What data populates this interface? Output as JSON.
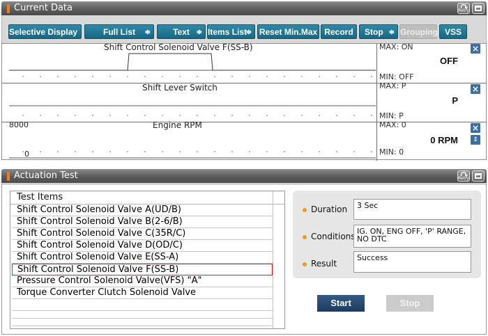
{
  "current_data": {
    "title": "Current Data",
    "retry_label": "Retry",
    "toolbar": [
      {
        "label": "Selective Display",
        "dropdown": true,
        "enabled": true
      },
      {
        "label": "Full List",
        "dropdown": true,
        "enabled": true
      },
      {
        "label": "Text",
        "dropdown": true,
        "enabled": true
      },
      {
        "label": "Items List",
        "dropdown": true,
        "enabled": true
      },
      {
        "label": "Reset Min.Max",
        "dropdown": false,
        "enabled": true
      },
      {
        "label": "Record",
        "dropdown": false,
        "enabled": true
      },
      {
        "label": "Stop",
        "dropdown": true,
        "enabled": true
      },
      {
        "label": "Grouping",
        "dropdown": false,
        "enabled": false
      },
      {
        "label": "VSS",
        "dropdown": false,
        "enabled": true
      }
    ],
    "graphs": [
      {
        "title": "Shift Control Solenoid Valve F(SS-B)",
        "max": "MAX: ON",
        "min": "MIN: OFF",
        "value": "OFF",
        "scale_top": "",
        "scale_bottom": ""
      },
      {
        "title": "Shift Lever Switch",
        "max": "MAX: P",
        "min": "MIN: P",
        "value": "P",
        "scale_top": "",
        "scale_bottom": ""
      },
      {
        "title": "Engine RPM",
        "max": "MAX: 0",
        "min": "MIN: 0",
        "value": "0 RPM",
        "scale_top": "8000",
        "scale_bottom": "0"
      }
    ]
  },
  "actuation_test": {
    "title": "Actuation Test",
    "retry_label": "Retry",
    "list_header": "Test Items",
    "items": [
      "Shift Control Solenoid Valve A(UD/B)",
      "Shift Control Solenoid Valve B(2-6/B)",
      "Shift Control Solenoid Valve C(35R/C)",
      "Shift Control Solenoid Valve D(OD/C)",
      "Shift Control Solenoid Valve E(SS-A)",
      "Shift Control Solenoid Valve F(SS-B)",
      "Pressure Control Solenoid Valve(VFS) \"A\"",
      "Torque Converter Clutch Solenoid Valve",
      "",
      "",
      "",
      ""
    ],
    "selected_index": 5,
    "duration_label": "Duration",
    "duration_value": "3 Sec",
    "conditions_label": "Conditions",
    "conditions_value": "IG. ON, ENG OFF, 'P' RANGE, NO DTC",
    "result_label": "Result",
    "result_value": "Success",
    "start_label": "Start",
    "stop_label": "Stop"
  },
  "colors": {
    "accent": "#176782",
    "header": "#5c5c5c",
    "selection": "#e02020",
    "bullet": "#f09a20"
  }
}
